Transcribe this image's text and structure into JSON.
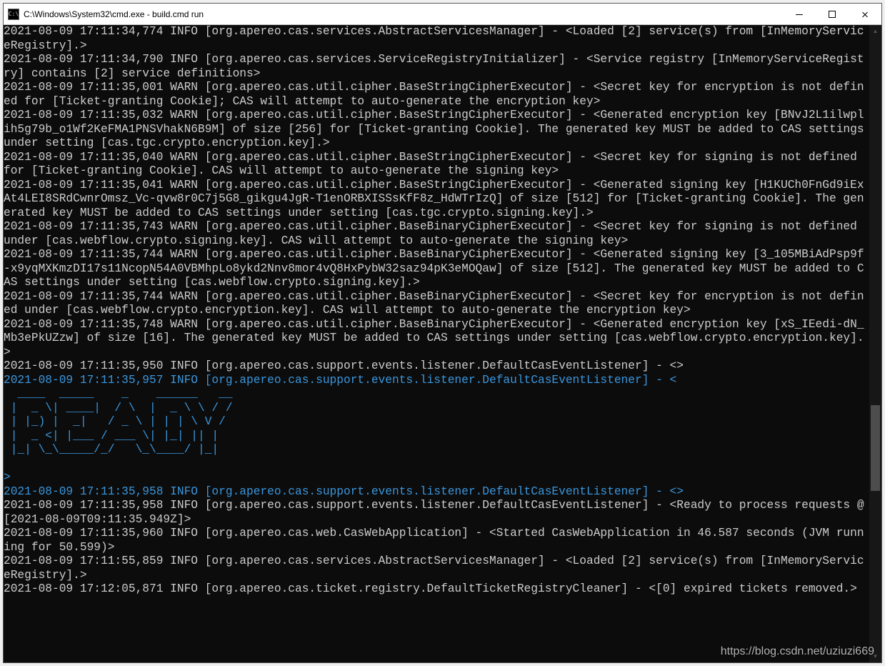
{
  "window": {
    "icon_label": "C:\\",
    "title": "C:\\Windows\\System32\\cmd.exe - build.cmd  run"
  },
  "watermark": "https://blog.csdn.net/uziuzi669",
  "log": {
    "l01": "2021-08-09 17:11:34,774 INFO [org.apereo.cas.services.AbstractServicesManager] - <Loaded [2] service(s) from [InMemoryServiceRegistry].>",
    "l02": "2021-08-09 17:11:34,790 INFO [org.apereo.cas.services.ServiceRegistryInitializer] - <Service registry [InMemoryServiceRegistry] contains [2] service definitions>",
    "l03": "2021-08-09 17:11:35,001 WARN [org.apereo.cas.util.cipher.BaseStringCipherExecutor] - <Secret key for encryption is not defined for [Ticket-granting Cookie]; CAS will attempt to auto-generate the encryption key>",
    "l04": "2021-08-09 17:11:35,032 WARN [org.apereo.cas.util.cipher.BaseStringCipherExecutor] - <Generated encryption key [BNvJ2L1ilwplih5g79b_o1Wf2KeFMA1PNSVhakN6B9M] of size [256] for [Ticket-granting Cookie]. The generated key MUST be added to CAS settings under setting [cas.tgc.crypto.encryption.key].>",
    "l05": "2021-08-09 17:11:35,040 WARN [org.apereo.cas.util.cipher.BaseStringCipherExecutor] - <Secret key for signing is not defined for [Ticket-granting Cookie]. CAS will attempt to auto-generate the signing key>",
    "l06": "2021-08-09 17:11:35,041 WARN [org.apereo.cas.util.cipher.BaseStringCipherExecutor] - <Generated signing key [H1KUCh0FnGd9iExAt4LEI8SRdCwnrOmsz_Vc-qvw8r0C7j5G8_gikgu4JgR-T1enORBXISSsKfF8z_HdWTrIzQ] of size [512] for [Ticket-granting Cookie]. The generated key MUST be added to CAS settings under setting [cas.tgc.crypto.signing.key].>",
    "l07": "2021-08-09 17:11:35,743 WARN [org.apereo.cas.util.cipher.BaseBinaryCipherExecutor] - <Secret key for signing is not defined under [cas.webflow.crypto.signing.key]. CAS will attempt to auto-generate the signing key>",
    "l08": "2021-08-09 17:11:35,744 WARN [org.apereo.cas.util.cipher.BaseBinaryCipherExecutor] - <Generated signing key [3_105MBiAdPsp9f-x9yqMXKmzDI17s11NcopN54A0VBMhpLo8ykd2Nnv8mor4vQ8HxPybW32saz94pK3eMOQaw] of size [512]. The generated key MUST be added to CAS settings under setting [cas.webflow.crypto.signing.key].>",
    "l09": "2021-08-09 17:11:35,744 WARN [org.apereo.cas.util.cipher.BaseBinaryCipherExecutor] - <Secret key for encryption is not defined under [cas.webflow.crypto.encryption.key]. CAS will attempt to auto-generate the encryption key>",
    "l10": "2021-08-09 17:11:35,748 WARN [org.apereo.cas.util.cipher.BaseBinaryCipherExecutor] - <Generated encryption key [xS_IEedi-dN_Mb3ePkUZzw] of size [16]. The generated key MUST be added to CAS settings under setting [cas.webflow.crypto.encryption.key].>",
    "l11": "2021-08-09 17:11:35,950 INFO [org.apereo.cas.support.events.listener.DefaultCasEventListener] - <>",
    "l12": "2021-08-09 17:11:35,957 INFO [org.apereo.cas.support.events.listener.DefaultCasEventListener] - <",
    "ascii": "\n  ____  _____    _    ______   __\n |  _ \\| ____|  / \\  |  _ \\ \\ / /\n | |_) |  _|   / _ \\ | | | \\ V / \n |  _ <| |___ / ___ \\| |_| || |  \n |_| \\_\\_____/_/   \\_\\____/ |_|  \n",
    "l13": ">",
    "l14": "2021-08-09 17:11:35,958 INFO [org.apereo.cas.support.events.listener.DefaultCasEventListener] - <>",
    "l15": "2021-08-09 17:11:35,958 INFO [org.apereo.cas.support.events.listener.DefaultCasEventListener] - <Ready to process requests @ [2021-08-09T09:11:35.949Z]>",
    "l16": "2021-08-09 17:11:35,960 INFO [org.apereo.cas.web.CasWebApplication] - <Started CasWebApplication in 46.587 seconds (JVM running for 50.599)>",
    "l17": "2021-08-09 17:11:55,859 INFO [org.apereo.cas.services.AbstractServicesManager] - <Loaded [2] service(s) from [InMemoryServiceRegistry].>",
    "l18": "2021-08-09 17:12:05,871 INFO [org.apereo.cas.ticket.registry.DefaultTicketRegistryCleaner] - <[0] expired tickets removed.>"
  }
}
